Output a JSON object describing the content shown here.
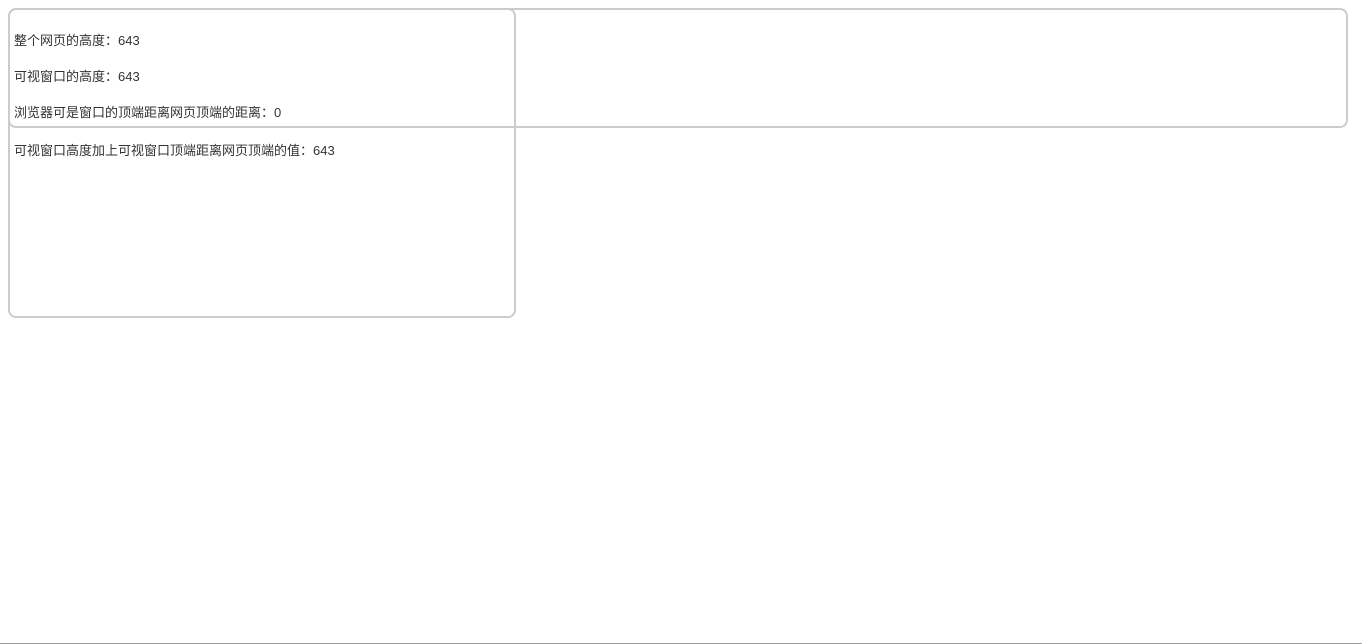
{
  "lines": {
    "l1": "整个网页的高度：643",
    "l2": "可视窗口的高度：643",
    "l3": "浏览器可是窗口的顶端距离网页顶端的距离：0",
    "l4": "可视窗口高度加上可视窗口顶端距离网页顶端的值：643"
  }
}
